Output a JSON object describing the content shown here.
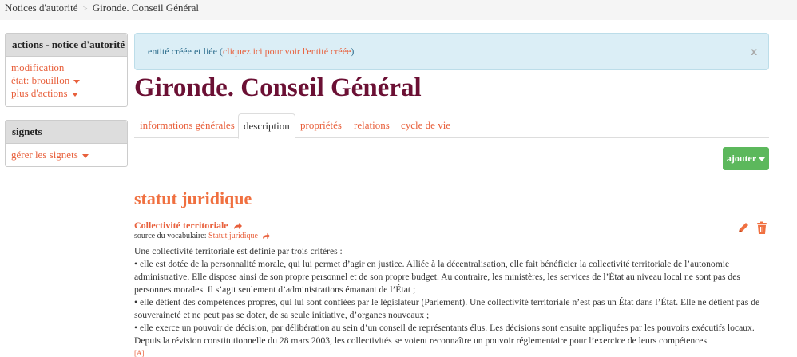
{
  "breadcrumb": {
    "items": [
      "Notices d'autorité",
      "Gironde. Conseil Général"
    ]
  },
  "sidebar": {
    "actions_panel": {
      "title": "actions - notice d'autorité",
      "items": [
        "modification",
        "état: brouillon",
        "plus d'actions"
      ]
    },
    "bookmarks_panel": {
      "title": "signets",
      "items": [
        "gérer les signets"
      ]
    }
  },
  "alert": {
    "text": "entité créée et liée (",
    "link": "cliquez ici pour voir l'entité créée",
    "text_end": ")",
    "close": "x"
  },
  "page_title": "Gironde. Conseil Général",
  "tabs": [
    "informations générales",
    "description",
    "propriétés",
    "relations",
    "cycle de vie"
  ],
  "active_tab": "description",
  "add_button": "ajouter",
  "section": {
    "title": "statut juridique",
    "term": "Collectivité territoriale",
    "vocab_label": "source du vocabulaire: ",
    "vocab_link": "Statut juridique",
    "definition": [
      "Une collectivité territoriale est définie par trois critères :",
      "• elle est dotée de la personnalité morale, qui lui permet d’agir en justice. Alliée à la décentralisation, elle fait bénéficier la collectivité territoriale de l’autonomie administrative. Elle dispose ainsi de son propre personnel et de son propre budget. Au contraire, les ministères, les services de l’État au niveau local ne sont pas des personnes morales. Il s’agit seulement d’administrations émanant de l’État ;",
      "• elle détient des compétences propres, qui lui sont confiées par le législateur (Parlement). Une collectivité territoriale n’est pas un État dans l’État. Elle ne détient pas de souveraineté et ne peut pas se doter, de sa seule initiative, d’organes nouveaux ;",
      "• elle exerce un pouvoir de décision, par délibération au sein d’un conseil de représentants élus. Les décisions sont ensuite appliquées par les pouvoirs exécutifs locaux. Depuis la révision constitutionnelle du 28 mars 2003, les collectivités se voient reconnaître un pouvoir réglementaire pour l’exercice de leurs compétences."
    ],
    "footnote": "[A]"
  },
  "colors": {
    "accent": "#e8603c",
    "title": "#6b1034",
    "alert_bg": "#dbeef6",
    "add_button": "#5cb85c"
  },
  "icons": [
    "share-arrow-icon",
    "pencil-icon",
    "trash-icon",
    "caret-down-icon",
    "close-icon"
  ]
}
